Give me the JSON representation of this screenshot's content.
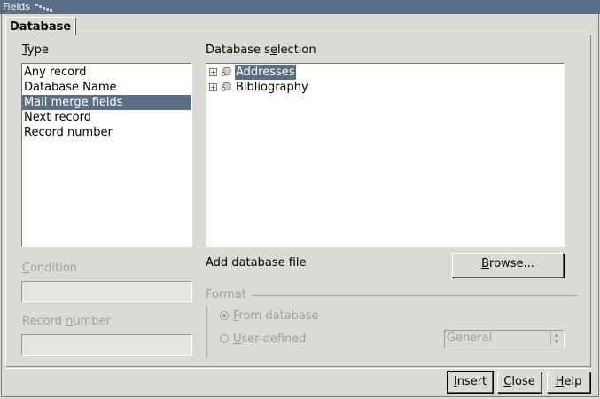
{
  "window": {
    "title": "Fields"
  },
  "tabs": [
    {
      "label": "Database"
    }
  ],
  "type_section": {
    "label_first": "T",
    "label_rest": "ype",
    "items": [
      "Any record",
      "Database Name",
      "Mail merge fields",
      "Next record",
      "Record number"
    ],
    "selected_index": 2
  },
  "db_selection": {
    "label_pre": "Database s",
    "label_mn": "e",
    "label_post": "lection",
    "items": [
      {
        "label": "Addresses",
        "selected": true,
        "icon": "database-icon"
      },
      {
        "label": "Bibliography",
        "selected": false,
        "icon": "database-icon"
      }
    ]
  },
  "condition": {
    "label_first": "C",
    "label_rest": "ondition",
    "value": ""
  },
  "record_number": {
    "label_pre": "Record ",
    "label_mn": "n",
    "label_post": "umber",
    "value": ""
  },
  "add_db": {
    "label": "Add database file",
    "browse_first": "B",
    "browse_rest": "rowse..."
  },
  "format": {
    "label": "Format",
    "from_db_first": "F",
    "from_db_rest": "rom database",
    "user_def_first": "U",
    "user_def_rest": "ser-defined",
    "combo_value": "General"
  },
  "footer": {
    "insert_first": "I",
    "insert_rest": "nsert",
    "close_first": "C",
    "close_rest": "lose",
    "help_first": "H",
    "help_rest": "elp"
  },
  "colors": {
    "selection": "#5a6f86",
    "background": "#dcdad5",
    "disabled_text": "#a3a19d"
  }
}
